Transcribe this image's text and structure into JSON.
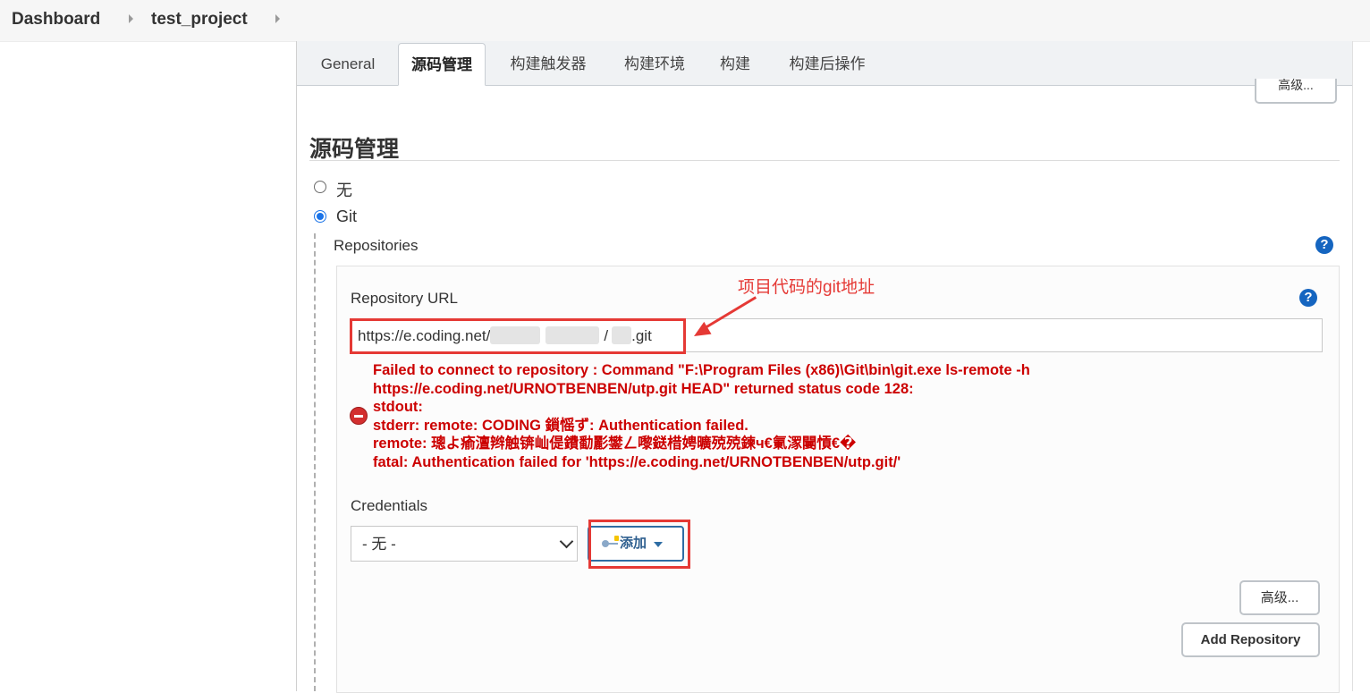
{
  "breadcrumb": {
    "items": [
      "Dashboard",
      "test_project"
    ]
  },
  "tabs": [
    {
      "label": "General",
      "active": false
    },
    {
      "label": "源码管理",
      "active": true
    },
    {
      "label": "构建触发器",
      "active": false
    },
    {
      "label": "构建环境",
      "active": false
    },
    {
      "label": "构建",
      "active": false
    },
    {
      "label": "构建后操作",
      "active": false
    }
  ],
  "top_advanced_label": "高级...",
  "section": {
    "title": "源码管理",
    "options": [
      {
        "label": "无",
        "checked": false
      },
      {
        "label": "Git",
        "checked": true
      }
    ]
  },
  "repositories": {
    "label": "Repositories",
    "help": "?",
    "repo_url": {
      "label": "Repository URL",
      "help": "?",
      "value_prefix": "https://e.coding.net/",
      "value_middle": "/",
      "value_suffix": ".git"
    },
    "error": {
      "lines": [
        "Failed to connect to repository : Command \"F:\\Program Files (x86)\\Git\\bin\\git.exe ls-remote -h",
        "https://e.coding.net/URNOTBENBEN/utp.git HEAD\" returned status code 128:",
        "stdout:",
        "stderr: remote: CODING 鎻愮ず: Authentication failed.",
        "remote: 璁よ瘉澶辫触锛屾偍鐨勫彲鐢ㄥ嚟鎹棤娉曠殑殑鍊ч€氭潈闄愩€�",
        "fatal: Authentication failed for 'https://e.coding.net/URNOTBENBEN/utp.git/'"
      ]
    },
    "credentials": {
      "label": "Credentials",
      "selected": "- 无 -",
      "add_label": "添加"
    },
    "advanced_label": "高级...",
    "add_repository_label": "Add Repository"
  },
  "annotation": {
    "text": "项目代码的git地址",
    "color": "#e53935"
  },
  "colors": {
    "error": "#cc0000",
    "accent": "#1565c0",
    "annotation": "#e53935"
  },
  "icons": [
    "chevron-right-icon",
    "help-icon",
    "error-icon",
    "key-icon",
    "caret-down-icon"
  ]
}
